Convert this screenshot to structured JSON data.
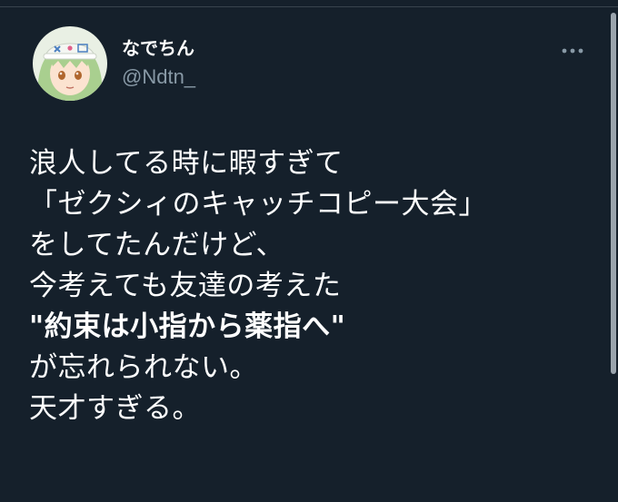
{
  "tweet": {
    "author": {
      "display_name": "なでちん",
      "handle": "@Ndtn_",
      "avatar_icon": "avatar-icon"
    },
    "more_icon": "more-horizontal-icon",
    "lines": [
      "浪人してる時に暇すぎて",
      "「ゼクシィのキャッチコピー大会」",
      "をしてたんだけど、",
      "今考えても友達の考えた",
      "\"約束は小指から薬指へ\"",
      "が忘れられない。",
      "天才すぎる。"
    ],
    "bold_line_index": 4
  },
  "colors": {
    "background": "#15202b",
    "text": "#ffffff",
    "secondary_text": "#8899a6",
    "divider": "#38444d"
  }
}
